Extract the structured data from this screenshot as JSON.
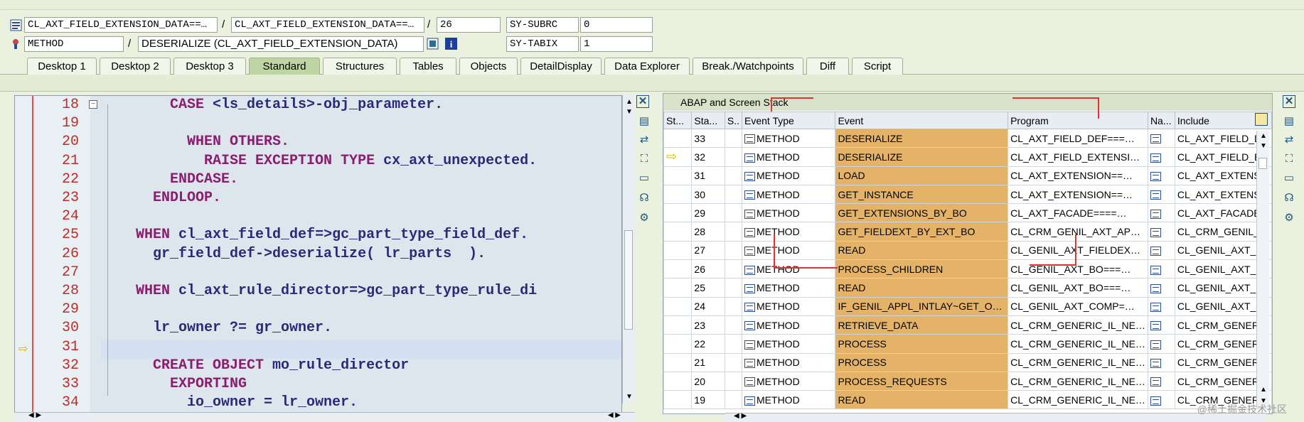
{
  "header": {
    "row1": {
      "field1": "CL_AXT_FIELD_EXTENSION_DATA==…",
      "field2": "CL_AXT_FIELD_EXTENSION_DATA==…",
      "line": "26",
      "sysvar": "SY-SUBRC",
      "sysval": "0"
    },
    "row2": {
      "type": "METHOD",
      "name": "DESERIALIZE (CL_AXT_FIELD_EXTENSION_DATA)",
      "sysvar": "SY-TABIX",
      "sysval": "1"
    },
    "separator": "/"
  },
  "tabs": [
    "Desktop 1",
    "Desktop 2",
    "Desktop 3",
    "Standard",
    "Structures",
    "Tables",
    "Objects",
    "DetailDisplay",
    "Data Explorer",
    "Break./Watchpoints",
    "Diff",
    "Script"
  ],
  "active_tab": "Standard",
  "editor": {
    "lines": [
      {
        "n": "18",
        "code": [
          [
            "kw",
            "          CASE "
          ],
          [
            "",
            "<ls_details>-obj_parameter."
          ]
        ]
      },
      {
        "n": "19",
        "code": []
      },
      {
        "n": "20",
        "code": [
          [
            "kw",
            "            WHEN OTHERS."
          ]
        ]
      },
      {
        "n": "21",
        "code": [
          [
            "kw",
            "              RAISE EXCEPTION TYPE "
          ],
          [
            "",
            "cx_axt_unexpected."
          ]
        ]
      },
      {
        "n": "22",
        "code": [
          [
            "kw",
            "          ENDCASE."
          ]
        ]
      },
      {
        "n": "23",
        "code": [
          [
            "kw",
            "        ENDLOOP."
          ]
        ]
      },
      {
        "n": "24",
        "code": []
      },
      {
        "n": "25",
        "code": [
          [
            "kw",
            "      WHEN "
          ],
          [
            "",
            "cl_axt_field_def=>gc_part_type_field_def."
          ]
        ]
      },
      {
        "n": "26",
        "code": [
          [
            "",
            "        gr_field_def->deserialize( lr_parts  )."
          ]
        ]
      },
      {
        "n": "27",
        "code": []
      },
      {
        "n": "28",
        "code": [
          [
            "kw",
            "      WHEN "
          ],
          [
            "",
            "cl_axt_rule_director=>gc_part_type_rule_di"
          ]
        ]
      },
      {
        "n": "29",
        "code": []
      },
      {
        "n": "30",
        "code": [
          [
            "",
            "        lr_owner ?= gr_owner."
          ]
        ]
      },
      {
        "n": "31",
        "code": []
      },
      {
        "n": "32",
        "code": [
          [
            "kw",
            "        CREATE OBJECT "
          ],
          [
            "",
            "mo_rule_director"
          ]
        ]
      },
      {
        "n": "33",
        "code": [
          [
            "kw",
            "          EXPORTING"
          ]
        ]
      },
      {
        "n": "34",
        "code": [
          [
            "",
            "            io_owner = lr_owner."
          ]
        ]
      }
    ]
  },
  "stack": {
    "title": "ABAP and Screen Stack",
    "columns": [
      "St...",
      "Sta...",
      "S..",
      "Event Type",
      "Event",
      "Program",
      "Na...",
      "Include"
    ],
    "rows": [
      {
        "level": "33",
        "etype": "METHOD",
        "event": "DESERIALIZE",
        "program": "CL_AXT_FIELD_DEF===…",
        "include": "CL_AXT_FIELD_DI"
      },
      {
        "level": "32",
        "etype": "METHOD",
        "event": "DESERIALIZE",
        "program": "CL_AXT_FIELD_EXTENSI…",
        "include": "CL_AXT_FIELD_E)",
        "current": true
      },
      {
        "level": "31",
        "etype": "METHOD",
        "event": "LOAD",
        "program": "CL_AXT_EXTENSION==…",
        "include": "CL_AXT_EXTENSI"
      },
      {
        "level": "30",
        "etype": "METHOD",
        "event": "GET_INSTANCE",
        "program": "CL_AXT_EXTENSION==…",
        "include": "CL_AXT_EXTENSI"
      },
      {
        "level": "29",
        "etype": "METHOD",
        "event": "GET_EXTENSIONS_BY_BO",
        "program": "CL_AXT_FACADE====…",
        "include": "CL_AXT_FACADE="
      },
      {
        "level": "28",
        "etype": "METHOD",
        "event": "GET_FIELDEXT_BY_EXT_BO",
        "program": "CL_CRM_GENIL_AXT_AP…",
        "include": "CL_CRM_GENIL_A"
      },
      {
        "level": "27",
        "etype": "METHOD",
        "event": "READ",
        "program": "CL_GENIL_AXT_FIELDEX…",
        "include": "CL_GENIL_AXT_F"
      },
      {
        "level": "26",
        "etype": "METHOD",
        "event": "PROCESS_CHILDREN",
        "program": "CL_GENIL_AXT_BO===…",
        "include": "CL_GENIL_AXT_B"
      },
      {
        "level": "25",
        "etype": "METHOD",
        "event": "READ",
        "program": "CL_GENIL_AXT_BO===…",
        "include": "CL_GENIL_AXT_B"
      },
      {
        "level": "24",
        "etype": "METHOD",
        "event": "IF_GENIL_APPL_INTLAY~GET_O…",
        "program": "CL_GENIL_AXT_COMP=…",
        "include": "CL_GENIL_AXT_C"
      },
      {
        "level": "23",
        "etype": "METHOD",
        "event": "RETRIEVE_DATA",
        "program": "CL_CRM_GENERIC_IL_NE…",
        "include": "CL_CRM_GENERIC"
      },
      {
        "level": "22",
        "etype": "METHOD",
        "event": "PROCESS",
        "program": "CL_CRM_GENERIC_IL_NE…",
        "include": "CL_CRM_GENERIC"
      },
      {
        "level": "21",
        "etype": "METHOD",
        "event": "PROCESS",
        "program": "CL_CRM_GENERIC_IL_NE…",
        "include": "CL_CRM_GENERIC"
      },
      {
        "level": "20",
        "etype": "METHOD",
        "event": "PROCESS_REQUESTS",
        "program": "CL_CRM_GENERIC_IL_NE…",
        "include": "CL_CRM_GENERIC"
      },
      {
        "level": "19",
        "etype": "METHOD",
        "event": "READ",
        "program": "CL_CRM_GENERIC_IL_NE…",
        "include": "CL_CRM_GENERIC"
      }
    ]
  },
  "watermark": "@稀土掘金技术社区",
  "colors": {
    "event_bg": "#e5b368",
    "active_tab": "#bfd4a3",
    "line_number": "#c02a2a",
    "keyword": "#8a1d6e"
  }
}
